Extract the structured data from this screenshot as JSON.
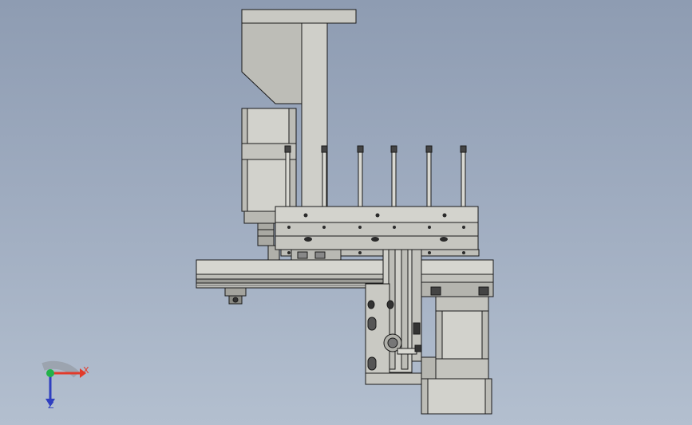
{
  "viewport": {
    "background_top": "#8e9cb2",
    "background_bottom": "#b3bfcf",
    "part_fill": "#c8c8c2",
    "part_stroke": "#1a1a1a"
  },
  "triad": {
    "x_label": "X",
    "z_label": "Z",
    "x_color": "#e23a2a",
    "y_color": "#22b24a",
    "z_color": "#2f3fc0"
  }
}
